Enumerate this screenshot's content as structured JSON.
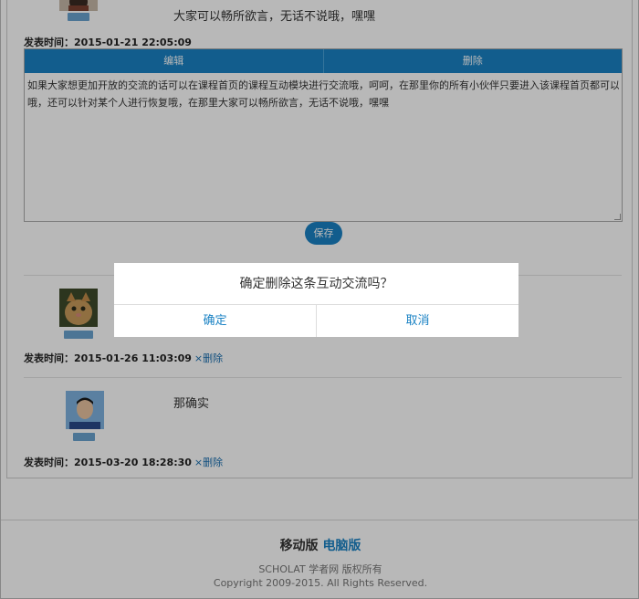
{
  "post1": {
    "text": "大家可以畅所欲言，无话不说哦，嘿嘿",
    "time_label": "发表时间：",
    "time": "2015-01-21 22:05:09"
  },
  "editor": {
    "tab_edit": "编辑",
    "tab_delete": "删除",
    "content_line1": "如果大家想更加开放的交流的话可以在课程首页的课程互动模块进行交流哦，呵呵，在那里你的所有小伙伴只要进入该课程首页都可以看到你的发言",
    "content_line2": "哦，还可以针对某个人进行恢复哦，在那里大家可以畅所欲言，无话不说哦，嘿嘿",
    "save_label": "保存"
  },
  "post2": {
    "time_label": "发表时间：",
    "time": "2015-01-26 11:03:09",
    "delete_label": "×删除"
  },
  "post3": {
    "text": "那确实",
    "time_label": "发表时间：",
    "time": "2015-03-20 18:28:30",
    "delete_label": "×删除"
  },
  "footer": {
    "mobile": "移动版",
    "pc": "电脑版",
    "brand": "SCHOLAT 学者网 版权所有",
    "copyright": "Copyright 2009-2015. All Rights Reserved."
  },
  "dialog": {
    "message": "确定删除这条互动交流吗？",
    "confirm": "确定",
    "cancel": "取消"
  },
  "colors": {
    "accent": "#1a82c4",
    "overlay": "rgba(0,0,0,0.28)"
  }
}
